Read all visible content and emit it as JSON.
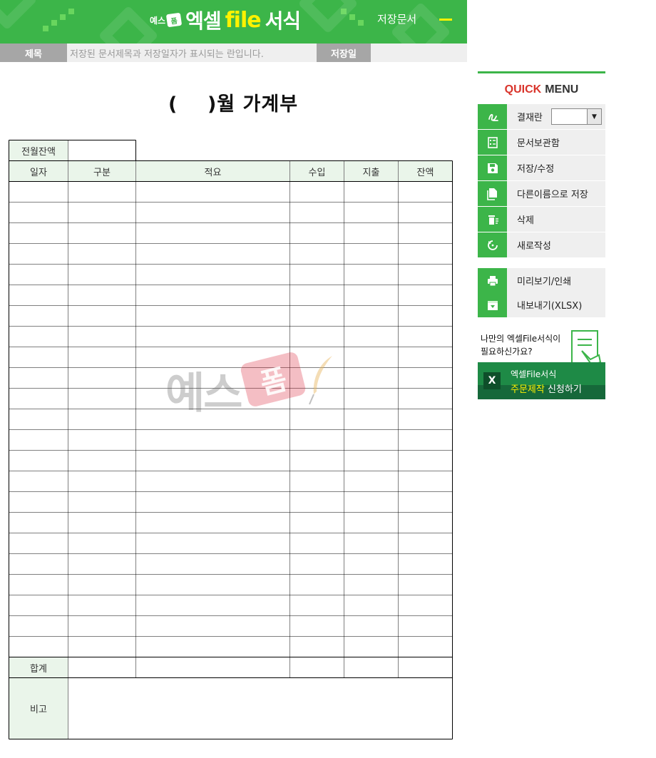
{
  "header": {
    "logo_small": "예스",
    "logo_badge": "폼",
    "logo_main": "엑셀",
    "logo_file": "file",
    "logo_suffix": "서식",
    "saved_docs": "저장문서",
    "colors": {
      "brand_green": "#3cb549",
      "accent_yellow": "#fff200"
    }
  },
  "title_strip": {
    "title_label": "제목",
    "title_placeholder": "저장된 문서제목과 저장일자가 표시되는 란입니다.",
    "date_label": "저장일",
    "date_value": ""
  },
  "sheet": {
    "title": "(    )월 가계부",
    "prev_balance_label": "전월잔액",
    "prev_balance_value": "",
    "columns": [
      "일자",
      "구분",
      "적요",
      "수입",
      "지출",
      "잔액"
    ],
    "row_count": 23,
    "total_label": "합계",
    "note_label": "비고"
  },
  "watermark": {
    "text": "예스",
    "badge": "폼"
  },
  "quick_menu": {
    "title_a": "QUICK",
    "title_b": "MENU",
    "approval_label": "결재란",
    "items": [
      {
        "label": "결재란",
        "icon": "signature-icon"
      },
      {
        "label": "문서보관함",
        "icon": "archive-list-icon"
      },
      {
        "label": "저장/수정",
        "icon": "floppy-icon"
      },
      {
        "label": "다른이름으로 저장",
        "icon": "copy-file-icon"
      },
      {
        "label": "삭제",
        "icon": "trash-icon"
      },
      {
        "label": "새로작성",
        "icon": "refresh-icon"
      },
      {
        "label": "미리보기/인쇄",
        "icon": "printer-icon"
      },
      {
        "label": "내보내기(XLSX)",
        "icon": "export-box-icon"
      }
    ]
  },
  "promo": {
    "question_line1": "나만의 엑셀File서식이",
    "question_line2": "필요하신가요?",
    "badge": "X",
    "line1": "엑셀File서식",
    "line2_highlight": "주문제작",
    "line2_rest": " 신청하기"
  }
}
